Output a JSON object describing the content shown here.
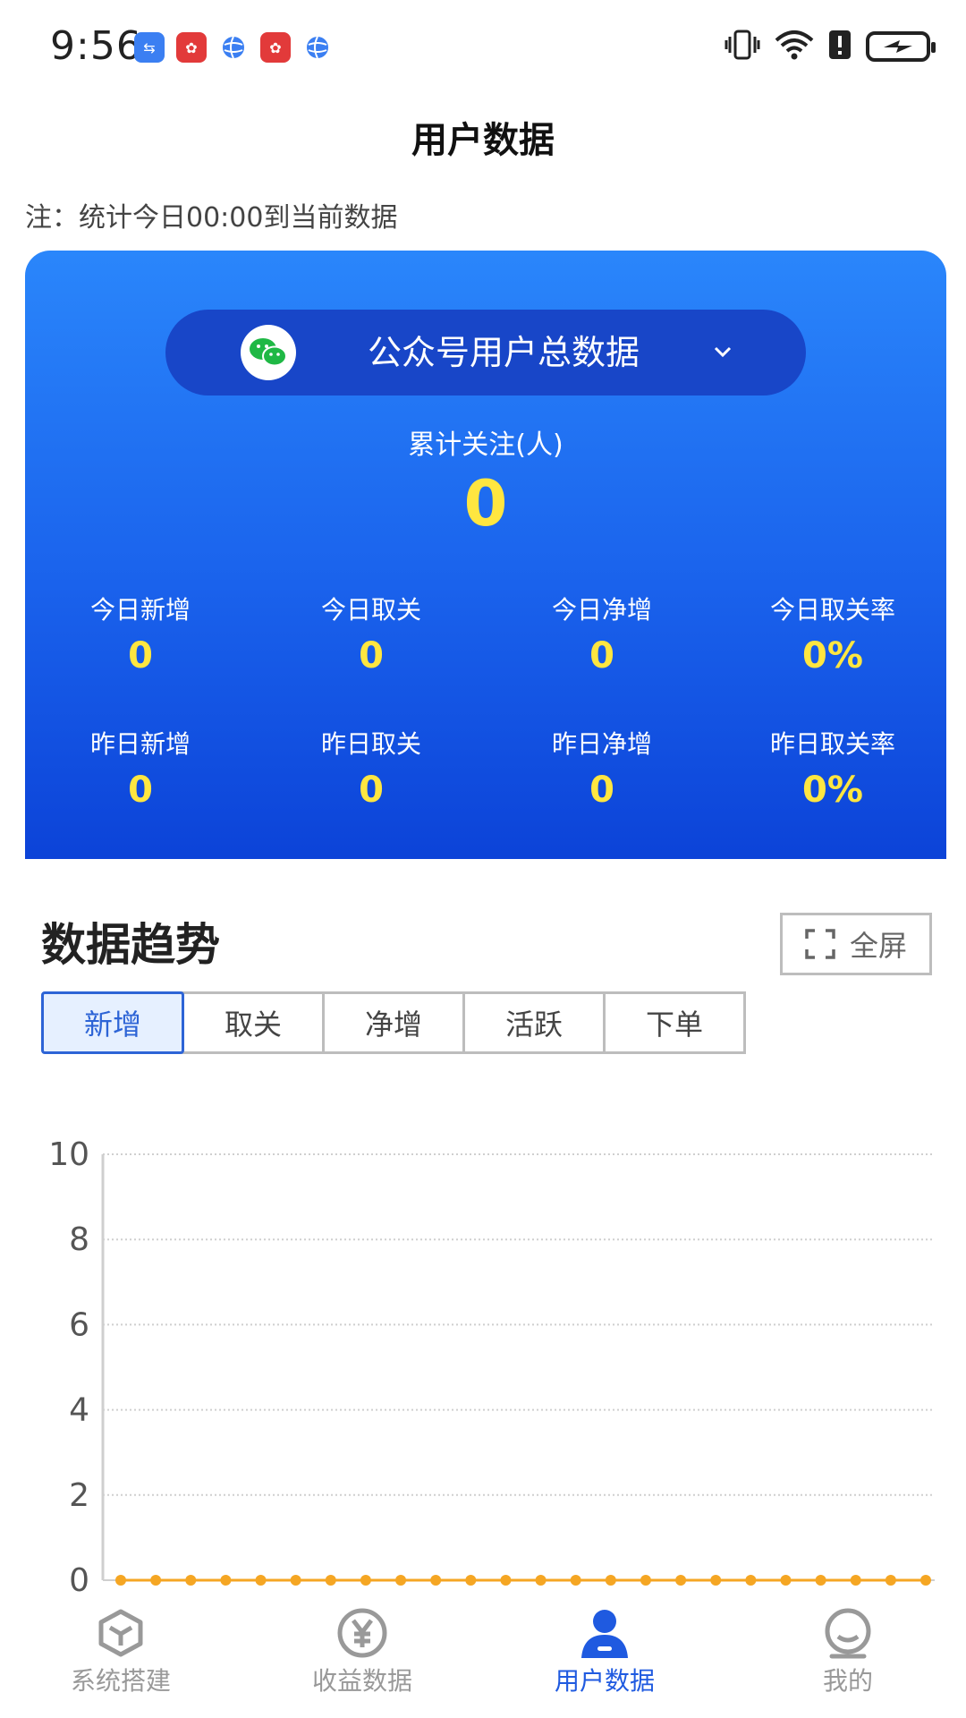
{
  "status_bar": {
    "time": "9:56",
    "notification_icons": [
      "usb-icon",
      "huawei-icon",
      "globe-icon",
      "huawei-icon",
      "globe-icon"
    ],
    "right_icons": [
      "vibrate-icon",
      "wifi-icon",
      "alert-icon",
      "battery-charging-icon"
    ]
  },
  "header": {
    "title": "用户数据",
    "note": "注：统计今日00:00到当前数据"
  },
  "summary": {
    "account_selector": "公众号用户总数据",
    "selector_icon": "wechat-icon",
    "total_label": "累计关注(人)",
    "total_value": "0",
    "today": [
      {
        "label": "今日新增",
        "value": "0"
      },
      {
        "label": "今日取关",
        "value": "0"
      },
      {
        "label": "今日净增",
        "value": "0"
      },
      {
        "label": "今日取关率",
        "value": "0%"
      }
    ],
    "yesterday": [
      {
        "label": "昨日新增",
        "value": "0"
      },
      {
        "label": "昨日取关",
        "value": "0"
      },
      {
        "label": "昨日净增",
        "value": "0"
      },
      {
        "label": "昨日取关率",
        "value": "0%"
      }
    ]
  },
  "trend": {
    "title": "数据趋势",
    "fullscreen_label": "全屏",
    "tabs": [
      "新增",
      "取关",
      "净增",
      "活跃",
      "下单"
    ],
    "active_tab": "新增"
  },
  "chart_data": {
    "type": "line",
    "y_ticks": [
      "0",
      "2",
      "4",
      "6",
      "8",
      "10"
    ],
    "ylim": [
      0,
      10
    ],
    "values": [
      0,
      0,
      0,
      0,
      0,
      0,
      0,
      0,
      0,
      0,
      0,
      0,
      0,
      0,
      0,
      0,
      0,
      0,
      0,
      0,
      0,
      0,
      0,
      0
    ],
    "grid": true,
    "color": "#f5a623"
  },
  "bottom_nav": [
    {
      "label": "系统搭建",
      "icon": "cube-icon",
      "active": false
    },
    {
      "label": "收益数据",
      "icon": "yen-icon",
      "active": false
    },
    {
      "label": "用户数据",
      "icon": "user-icon",
      "active": true
    },
    {
      "label": "我的",
      "icon": "profile-icon",
      "active": false
    }
  ],
  "colors": {
    "accent": "#1f5ae0",
    "highlight_value": "#ffe640",
    "line": "#f5a623"
  }
}
